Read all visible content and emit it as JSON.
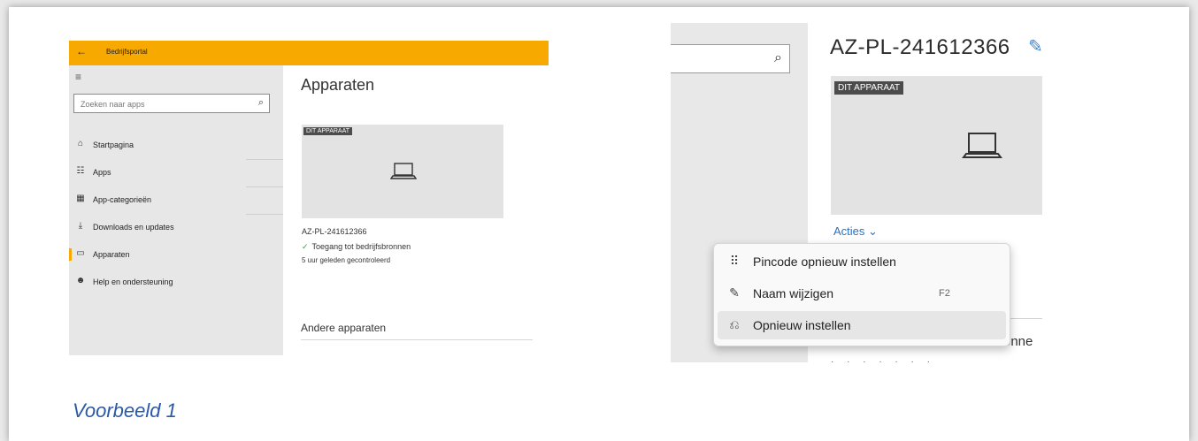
{
  "left_shot": {
    "titlebar": {
      "back_icon": "←",
      "title": "Bedrijfsportal",
      "color": "#f7a900"
    },
    "menu_icon": "≡",
    "search": {
      "placeholder": "Zoeken naar apps",
      "icon": "⌕"
    },
    "nav": [
      {
        "label": "Startpagina",
        "icon": "⌂"
      },
      {
        "label": "Apps",
        "icon": "☷"
      },
      {
        "label": "App-categorieën",
        "icon": "▦"
      },
      {
        "label": "Downloads en updates",
        "icon": "⤓"
      },
      {
        "label": "Apparaten",
        "icon": "▭",
        "active": true
      },
      {
        "label": "Help en ondersteuning",
        "icon": "☻"
      }
    ],
    "main": {
      "title": "Apparaten",
      "badge": "DIT APPARAAT",
      "device_name": "AZ-PL-241612366",
      "status_icon": "✓",
      "status": "Toegang tot bedrijfsbronnen",
      "checked": "5 uur geleden gecontroleerd",
      "other_devices": "Andere apparaten"
    }
  },
  "right_shot": {
    "search_icon": "⌕",
    "device_title": "AZ-PL-241612366",
    "edit_icon": "✎",
    "badge": "DIT APPARAAT",
    "actions_label": "Acties",
    "actions_chevron": "⌄",
    "partial_text": "onne",
    "menu": [
      {
        "label": "Pincode opnieuw instellen",
        "icon": "⠿",
        "shortcut": ""
      },
      {
        "label": "Naam wijzigen",
        "icon": "✎",
        "shortcut": "F2"
      },
      {
        "label": "Opnieuw instellen",
        "icon": "⎌",
        "shortcut": "",
        "highlighted": true
      }
    ]
  },
  "caption": "Voorbeeld 1"
}
